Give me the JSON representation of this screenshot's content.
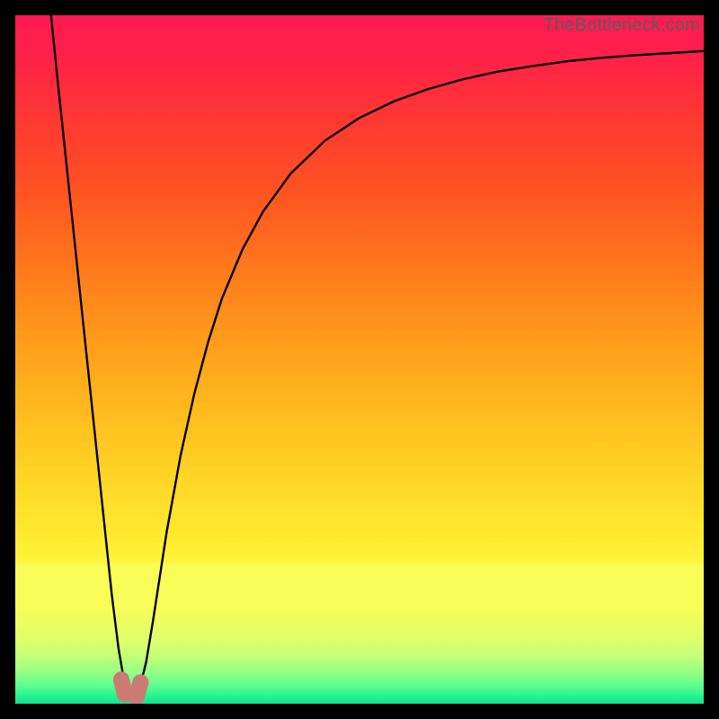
{
  "watermark": "TheBottleneck.com",
  "colors": {
    "black": "#000000",
    "curve": "#000000",
    "marker": "#cc7a74",
    "gradient_stops": [
      {
        "offset": 0.0,
        "color": "#ff1a52"
      },
      {
        "offset": 0.05,
        "color": "#ff1f4c"
      },
      {
        "offset": 0.15,
        "color": "#ff3833"
      },
      {
        "offset": 0.25,
        "color": "#ff5223"
      },
      {
        "offset": 0.35,
        "color": "#ff731d"
      },
      {
        "offset": 0.45,
        "color": "#ff951b"
      },
      {
        "offset": 0.55,
        "color": "#ffb41d"
      },
      {
        "offset": 0.65,
        "color": "#ffd024"
      },
      {
        "offset": 0.75,
        "color": "#ffe92f"
      },
      {
        "offset": 0.79,
        "color": "#fff438"
      },
      {
        "offset": 0.8,
        "color": "#f8fd58"
      },
      {
        "offset": 0.86,
        "color": "#f8fd58"
      },
      {
        "offset": 0.905,
        "color": "#dfff6a"
      },
      {
        "offset": 0.93,
        "color": "#c7ff77"
      },
      {
        "offset": 0.955,
        "color": "#94ff85"
      },
      {
        "offset": 0.975,
        "color": "#5aff8f"
      },
      {
        "offset": 0.988,
        "color": "#28f593"
      },
      {
        "offset": 1.0,
        "color": "#14e18e"
      }
    ]
  },
  "chart_data": {
    "type": "line",
    "title": "",
    "xlabel": "",
    "ylabel": "",
    "xlim": [
      0,
      100
    ],
    "ylim": [
      0,
      100
    ],
    "grid": false,
    "series": [
      {
        "name": "bottleneck-curve",
        "x": [
          5.2,
          6,
          7,
          8,
          9,
          10,
          11,
          12,
          13,
          14,
          15,
          16,
          16.5,
          17.1,
          18,
          19,
          20,
          22,
          24,
          26,
          28,
          30,
          33,
          36,
          40,
          45,
          50,
          55,
          60,
          65,
          70,
          75,
          80,
          85,
          90,
          95,
          100
        ],
        "y": [
          100,
          92,
          82.5,
          73,
          63.5,
          54,
          44.5,
          35,
          25.5,
          16,
          8,
          2.2,
          0.7,
          0.6,
          2.0,
          6,
          12,
          25,
          36,
          45,
          52.5,
          58.8,
          66,
          71.5,
          77,
          81.8,
          85.1,
          87.5,
          89.3,
          90.7,
          91.8,
          92.6,
          93.3,
          93.8,
          94.2,
          94.5,
          94.8
        ]
      }
    ],
    "markers": [
      {
        "x": 15.4,
        "y": 3.5
      },
      {
        "x": 15.9,
        "y": 1.4
      },
      {
        "x": 17.6,
        "y": 1.0
      },
      {
        "x": 18.2,
        "y": 3.1
      }
    ],
    "legend": false
  }
}
